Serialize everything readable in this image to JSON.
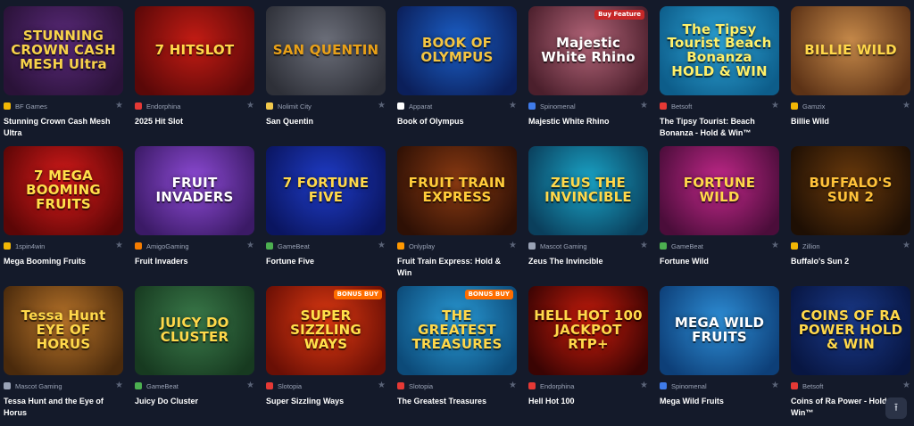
{
  "accent": "#141a2a",
  "games": [
    {
      "name": "Stunning Crown Cash Mesh Ultra",
      "provider": "BF Games",
      "thumb_text": "STUNNING CROWN CASH MESH Ultra",
      "bg": "#5a2a7a",
      "bg2": "#2a1238",
      "text_color": "#f7d24a",
      "prov_color": "#f2b705"
    },
    {
      "name": "2025 Hit Slot",
      "provider": "Endorphina",
      "thumb_text": "7 HITSLOT",
      "bg": "#c41c14",
      "bg2": "#5a0808",
      "text_color": "#ffd84a",
      "prov_color": "#e53935"
    },
    {
      "name": "San Quentin",
      "provider": "Nolimit City",
      "thumb_text": "SAN QUENTIN",
      "bg": "#6c6f7a",
      "bg2": "#2e3038",
      "text_color": "#e8a018",
      "prov_color": "#f2c94c"
    },
    {
      "name": "Book of Olympus",
      "provider": "Apparat",
      "thumb_text": "BOOK OF OLYMPUS",
      "bg": "#1b5fc7",
      "bg2": "#0b1f5a",
      "text_color": "#f4c542",
      "prov_color": "#ffffff"
    },
    {
      "name": "Majestic White Rhino",
      "provider": "Spinomenal",
      "thumb_text": "Majestic White Rhino",
      "bg": "#b5667a",
      "bg2": "#4b1f2c",
      "text_color": "#ffffff",
      "prov_color": "#3f7bea",
      "badge": "Buy Feature",
      "badge_color": "#c62828"
    },
    {
      "name": "The Tipsy Tourist: Beach Bonanza - Hold & Win™",
      "provider": "Betsoft",
      "thumb_text": "The Tipsy Tourist Beach Bonanza HOLD & WIN",
      "bg": "#2ea5d8",
      "bg2": "#0d5d8a",
      "text_color": "#fff06a",
      "prov_color": "#e53935"
    },
    {
      "name": "Billie Wild",
      "provider": "Gamzix",
      "thumb_text": "BILLIE WILD",
      "bg": "#c78a4a",
      "bg2": "#5c3216",
      "text_color": "#ffd84a",
      "prov_color": "#f2b705"
    },
    {
      "name": "Mega Booming Fruits",
      "provider": "1spin4win",
      "thumb_text": "7 MEGA BOOMING FRUITS",
      "bg": "#d81b1b",
      "bg2": "#5c0606",
      "text_color": "#ffe04a",
      "prov_color": "#f2b705"
    },
    {
      "name": "Fruit Invaders",
      "provider": "AmigoGaming",
      "thumb_text": "FRUIT INVADERS",
      "bg": "#8e4bd6",
      "bg2": "#3b1a66",
      "text_color": "#ffffff",
      "prov_color": "#f57c00"
    },
    {
      "name": "Fortune Five",
      "provider": "GameBeat",
      "thumb_text": "7 FORTUNE FIVE",
      "bg": "#1f3cc7",
      "bg2": "#0a1560",
      "text_color": "#ffd84a",
      "prov_color": "#4caf50"
    },
    {
      "name": "Fruit Train Express: Hold & Win",
      "provider": "Onlyplay",
      "thumb_text": "FRUIT TRAIN EXPRESS",
      "bg": "#8a3a12",
      "bg2": "#2e1005",
      "text_color": "#ffcc3a",
      "prov_color": "#ff9800"
    },
    {
      "name": "Zeus The Invincible",
      "provider": "Mascot Gaming",
      "thumb_text": "ZEUS THE INVINCIBLE",
      "bg": "#1aa5c8",
      "bg2": "#0a3f5c",
      "text_color": "#ffd84a",
      "prov_color": "#9aa3b6"
    },
    {
      "name": "Fortune Wild",
      "provider": "GameBeat",
      "thumb_text": "FORTUNE WILD",
      "bg": "#c2288a",
      "bg2": "#4b0d3a",
      "text_color": "#ffd84a",
      "prov_color": "#4caf50"
    },
    {
      "name": "Buffalo's Sun 2",
      "provider": "Zillion",
      "thumb_text": "BUFFALO'S SUN 2",
      "bg": "#6a3a0c",
      "bg2": "#1e0f04",
      "text_color": "#ffc23a",
      "prov_color": "#f2b705"
    },
    {
      "name": "Tessa Hunt and the Eye of Horus",
      "provider": "Mascot Gaming",
      "thumb_text": "Tessa Hunt EYE OF HORUS",
      "bg": "#b8742a",
      "bg2": "#4a2a0c",
      "text_color": "#ffd84a",
      "prov_color": "#9aa3b6"
    },
    {
      "name": "Juicy Do Cluster",
      "provider": "GameBeat",
      "thumb_text": "JUICY DO CLUSTER",
      "bg": "#3a7a4a",
      "bg2": "#173a20",
      "text_color": "#ffd84a",
      "prov_color": "#4caf50"
    },
    {
      "name": "Super Sizzling Ways",
      "provider": "Slotopia",
      "thumb_text": "SUPER SIZZLING WAYS",
      "bg": "#e03a12",
      "bg2": "#6a0f05",
      "text_color": "#ffe04a",
      "prov_color": "#e53935",
      "badge": "BONUS BUY",
      "badge_color": "#ff6d00"
    },
    {
      "name": "The Greatest Treasures",
      "provider": "Slotopia",
      "thumb_text": "THE GREATEST TREASURES",
      "bg": "#2a9bd6",
      "bg2": "#0c4a78",
      "text_color": "#ffd84a",
      "prov_color": "#e53935",
      "badge": "BONUS BUY",
      "badge_color": "#ff6d00"
    },
    {
      "name": "Hell Hot 100",
      "provider": "Endorphina",
      "thumb_text": "HELL HOT 100 JACKPOT RTP+",
      "bg": "#c81c0c",
      "bg2": "#3a0403",
      "text_color": "#ffd84a",
      "prov_color": "#e53935"
    },
    {
      "name": "Mega Wild Fruits",
      "provider": "Spinomenal",
      "thumb_text": "MEGA WILD FRUITS",
      "bg": "#2e8ed6",
      "bg2": "#0d3f78",
      "text_color": "#ffffff",
      "prov_color": "#3f7bea"
    },
    {
      "name": "Coins of Ra Power - Hold & Win™",
      "provider": "Betsoft",
      "thumb_text": "COINS OF RA POWER HOLD & WIN",
      "bg": "#1a3a8a",
      "bg2": "#081642",
      "text_color": "#ffd84a",
      "prov_color": "#e53935"
    }
  ],
  "scroll_top_icon": "arrow-up-icon",
  "star_glyph": "★",
  "arrow_glyph": "⭱"
}
